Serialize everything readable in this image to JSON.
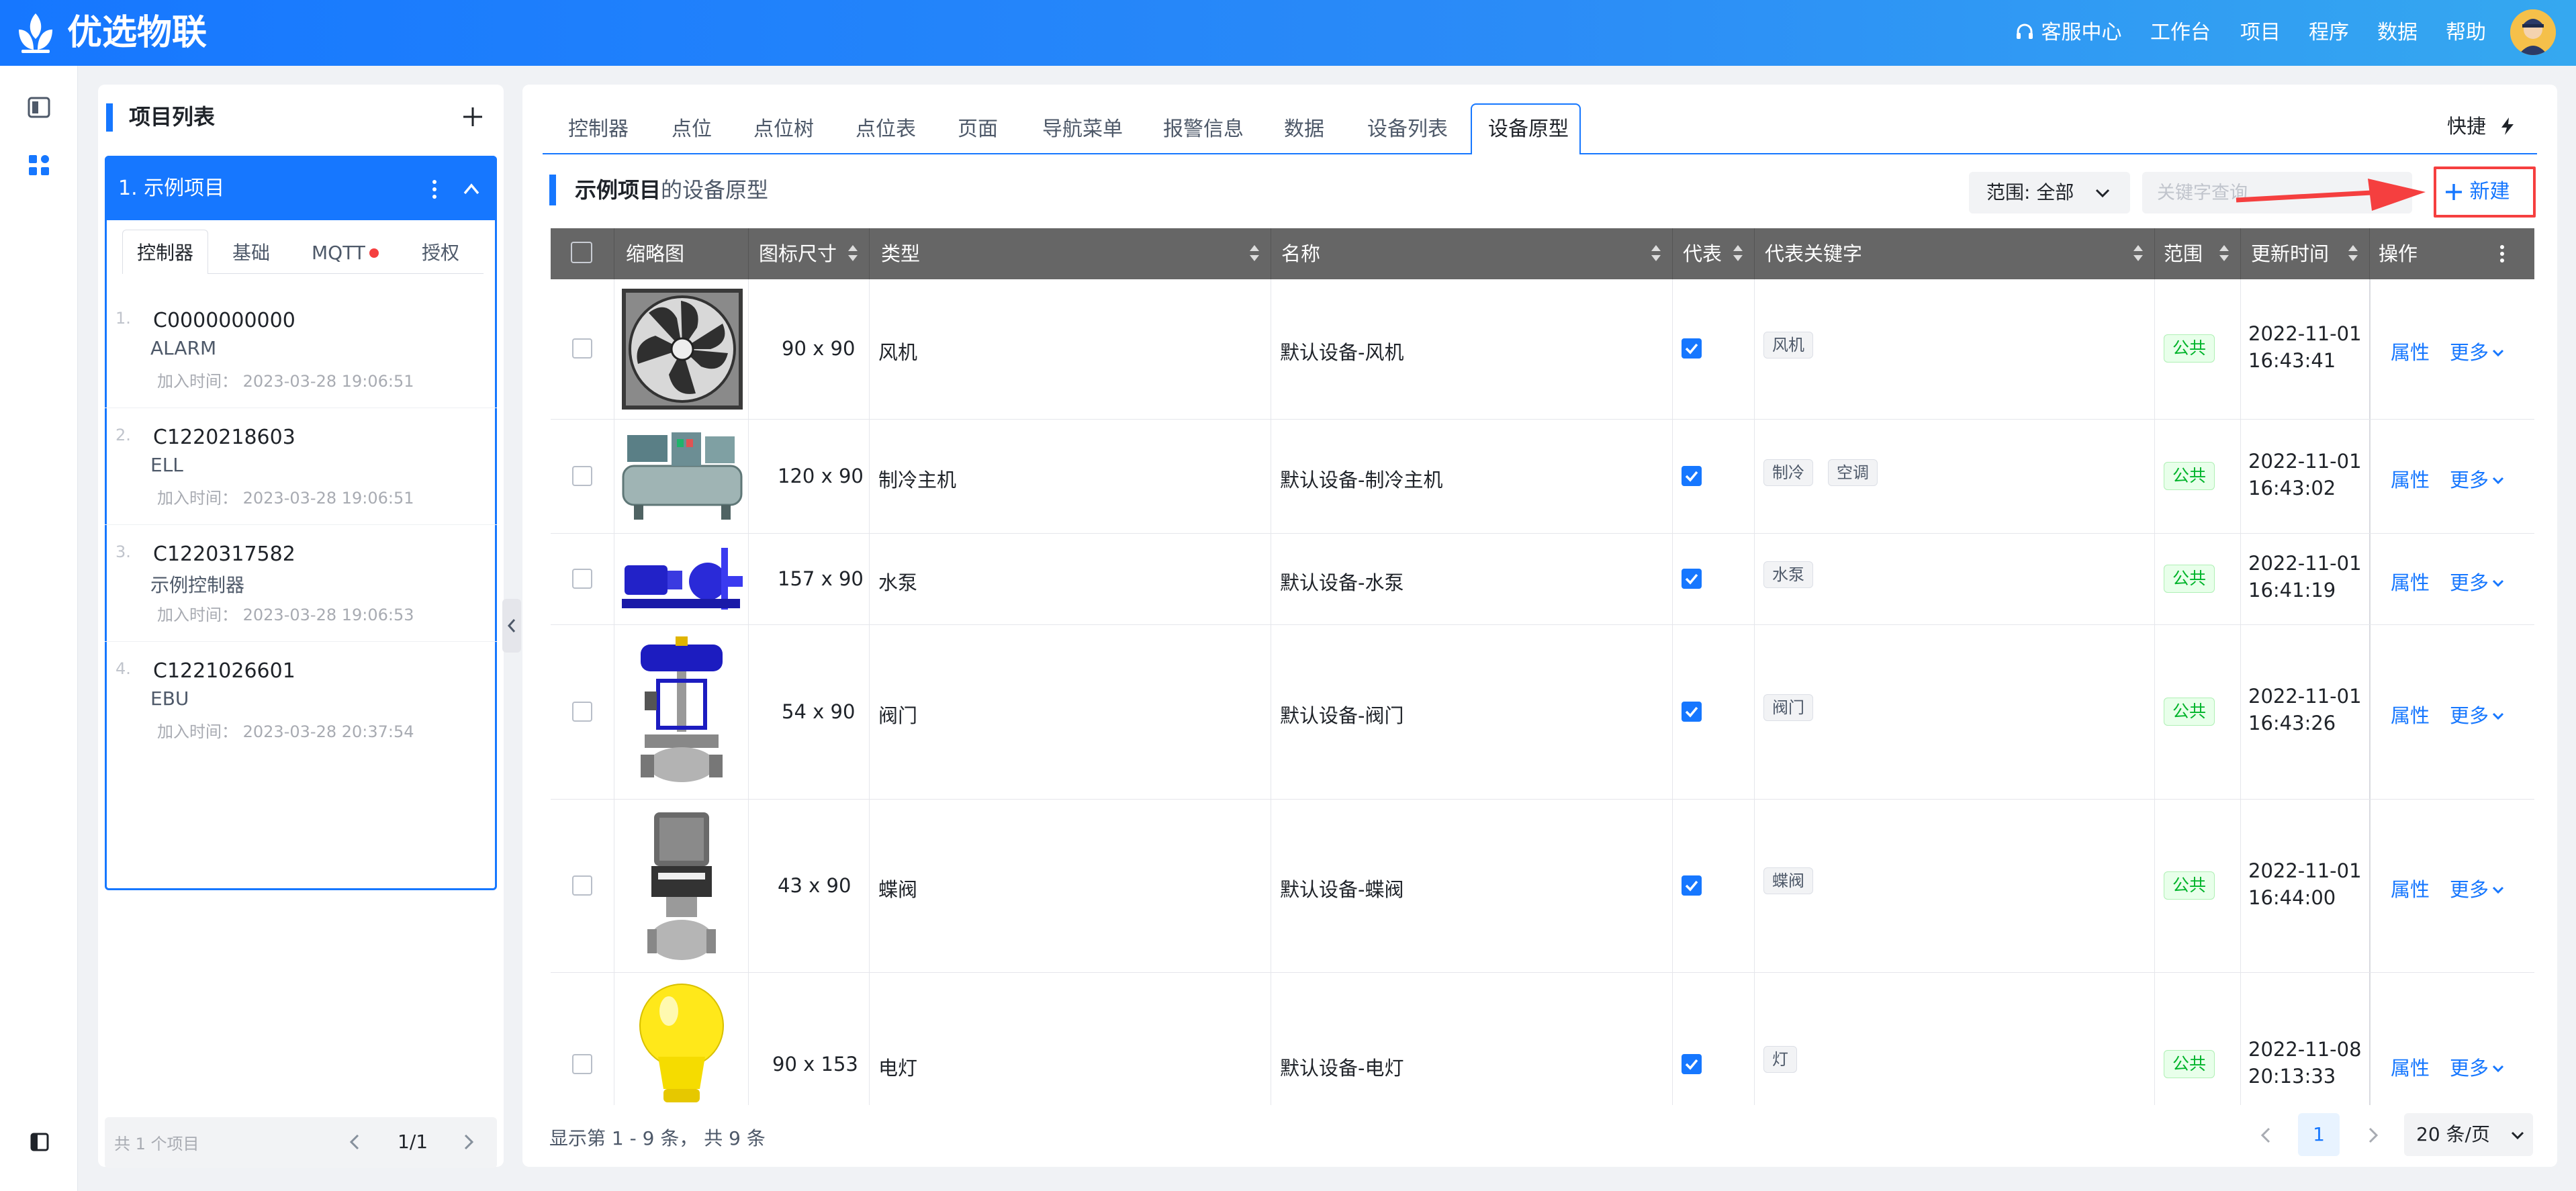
{
  "brand": {
    "name": "优选物联"
  },
  "nav": {
    "service": "客服中心",
    "workbench": "工作台",
    "project": "项目",
    "program": "程序",
    "data": "数据",
    "help": "帮助"
  },
  "left": {
    "title": "项目列表",
    "project": "1. 示例项目",
    "tabs": [
      "控制器",
      "基础",
      "MQTT",
      "授权"
    ],
    "items": [
      {
        "idx": "1.",
        "code": "C0000000000",
        "name": "ALARM",
        "time": "加入时间： 2023-03-28 19:06:51"
      },
      {
        "idx": "2.",
        "code": "C1220218603",
        "name": "ELL",
        "time": "加入时间： 2023-03-28 19:06:51"
      },
      {
        "idx": "3.",
        "code": "C1220317582",
        "name": "示例控制器",
        "time": "加入时间： 2023-03-28 19:06:53"
      },
      {
        "idx": "4.",
        "code": "C1221026601",
        "name": "EBU",
        "time": "加入时间： 2023-03-28 20:37:54"
      }
    ],
    "footer": {
      "count": "共 1 个项目",
      "page": "1/1"
    }
  },
  "main": {
    "tabs": [
      "控制器",
      "点位",
      "点位树",
      "点位表",
      "页面",
      "导航菜单",
      "报警信息",
      "数据",
      "设备列表",
      "设备原型"
    ],
    "quick": "快捷",
    "title_project": "示例项目",
    "title_suffix": "的设备原型",
    "scope": "范围: 全部",
    "search_placeholder": "关键字查询",
    "new_button": "新建",
    "columns": [
      "缩略图",
      "图标尺寸",
      "类型",
      "名称",
      "代表",
      "代表关键字",
      "范围",
      "更新时间",
      "操作"
    ],
    "rows": [
      {
        "size": "90 x 90",
        "type": "风机",
        "name": "默认设备-风机",
        "tags": [
          "风机"
        ],
        "scope": "公共",
        "date": "2022-11-01",
        "time": "16:43:41",
        "attr": "属性",
        "more": "更多"
      },
      {
        "size": "120 x 90",
        "type": "制冷主机",
        "name": "默认设备-制冷主机",
        "tags": [
          "制冷",
          "空调"
        ],
        "scope": "公共",
        "date": "2022-11-01",
        "time": "16:43:02",
        "attr": "属性",
        "more": "更多"
      },
      {
        "size": "157 x 90",
        "type": "水泵",
        "name": "默认设备-水泵",
        "tags": [
          "水泵"
        ],
        "scope": "公共",
        "date": "2022-11-01",
        "time": "16:41:19",
        "attr": "属性",
        "more": "更多"
      },
      {
        "size": "54 x 90",
        "type": "阀门",
        "name": "默认设备-阀门",
        "tags": [
          "阀门"
        ],
        "scope": "公共",
        "date": "2022-11-01",
        "time": "16:43:26",
        "attr": "属性",
        "more": "更多"
      },
      {
        "size": "43 x 90",
        "type": "蝶阀",
        "name": "默认设备-蝶阀",
        "tags": [
          "蝶阀"
        ],
        "scope": "公共",
        "date": "2022-11-01",
        "time": "16:44:00",
        "attr": "属性",
        "more": "更多"
      },
      {
        "size": "90 x 153",
        "type": "电灯",
        "name": "默认设备-电灯",
        "tags": [
          "灯"
        ],
        "scope": "公共",
        "date": "2022-11-08",
        "time": "20:13:33",
        "attr": "属性",
        "more": "更多"
      }
    ],
    "footer": {
      "summary": "显示第 1 - 9 条， 共 9 条",
      "page": "1",
      "page_size": "20 条/页"
    }
  }
}
